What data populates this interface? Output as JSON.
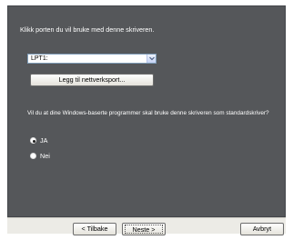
{
  "instruction": "Klikk porten du vil bruke med denne skriveren.",
  "port_select": {
    "value": "LPT1:",
    "icon": "chevron-down-icon"
  },
  "add_port_button": "Legg til nettverksport...",
  "default_question": "Vil du at dine Windows-baserte programmer skal bruke denne skriveren som standardskriver?",
  "default_options": [
    {
      "label": "JA",
      "selected": true
    },
    {
      "label": "Nei",
      "selected": false
    }
  ],
  "footer": {
    "back_label": "< Tilbake",
    "next_label": "Neste >",
    "cancel_label": "Avbryt"
  },
  "colors": {
    "panel_bg": "#55575a",
    "footer_bg": "#ecebe6",
    "text": "#ffffff"
  }
}
